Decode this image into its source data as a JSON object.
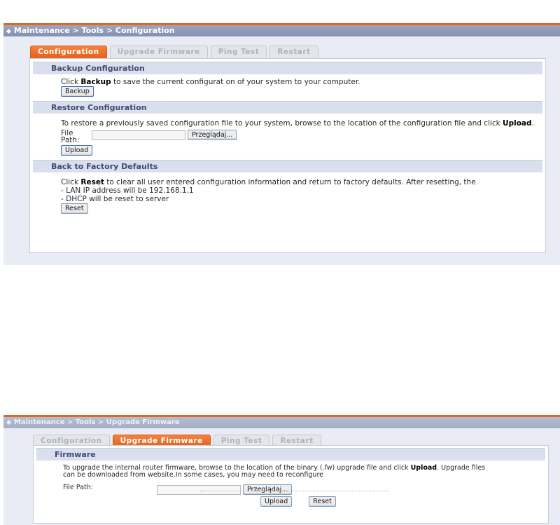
{
  "screen1": {
    "breadcrumb": "Maintenance > Tools > Configuration",
    "tabs": [
      "Configuration",
      "Upgrade Firmware",
      "Ping Test",
      "Restart"
    ],
    "active_tab": "Configuration",
    "backup": {
      "heading": "Backup Configuration",
      "text_pre": "Click ",
      "text_bold": "Backup",
      "text_post": " to save the current configurat on of your system to your computer.",
      "button": "Backup"
    },
    "restore": {
      "heading": "Restore Configuration",
      "text_pre": "To restore a previously saved configuration file to your system, browse to the location of the configuration file and click ",
      "text_bold": "Upload",
      "text_post": ".",
      "file_label": "File Path:",
      "browse_button": "Przeglądaj...",
      "upload_button": "Upload"
    },
    "factory": {
      "heading": "Back to Factory Defaults",
      "text_pre": "Click ",
      "text_bold": "Reset",
      "text_post": " to clear all user entered configuration information and return to factory defaults. After resetting, the",
      "line2": "- LAN IP address will be 192.168.1.1",
      "line3": "- DHCP will be reset to server",
      "reset_button": "Reset"
    }
  },
  "screen2": {
    "breadcrumb": "Maintenance > Tools > Upgrade Firmware",
    "tabs": [
      "Configuration",
      "Upgrade Firmware",
      "Ping Test",
      "Restart"
    ],
    "active_tab": "Upgrade Firmware",
    "firmware": {
      "heading": "Firmware",
      "text_pre": "To upgrade the internal router firmware, browse to the location of the binary (.fw) upgrade file and click ",
      "text_bold": "Upload",
      "text_post": ". Upgrade files",
      "line2": "can be downloaded from website.In some cases, you may need to reconfigure",
      "file_label": "File Path:",
      "browse_button": "Przeglądaj...",
      "upload_button": "Upload",
      "reset_button": "Reset"
    }
  }
}
